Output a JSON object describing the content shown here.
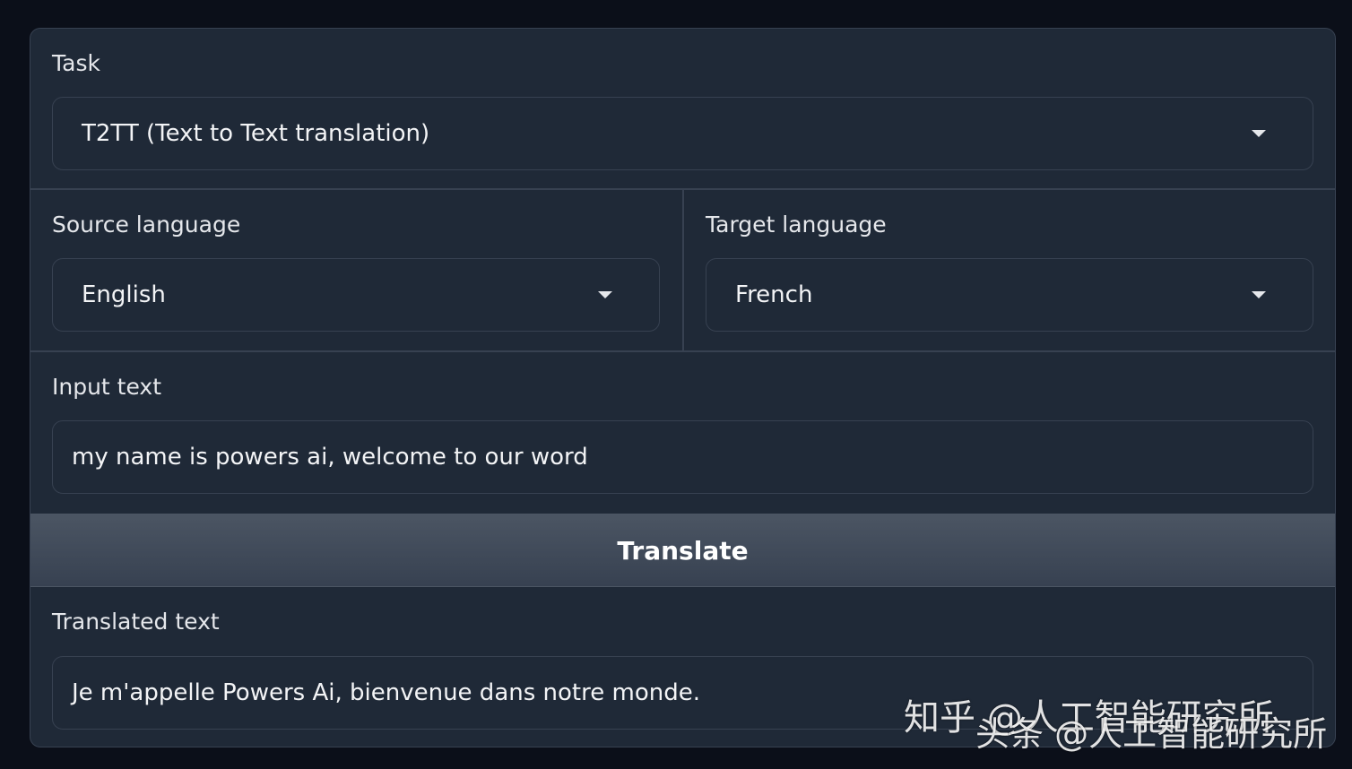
{
  "task": {
    "label": "Task",
    "value": "T2TT (Text to Text translation)"
  },
  "source_language": {
    "label": "Source language",
    "value": "English"
  },
  "target_language": {
    "label": "Target language",
    "value": "French"
  },
  "input_text": {
    "label": "Input text",
    "value": "my name is powers ai, welcome to our word"
  },
  "translate_button": {
    "label": "Translate"
  },
  "translated_text": {
    "label": "Translated text",
    "value": "Je m'appelle Powers Ai, bienvenue dans notre monde."
  },
  "watermarks": {
    "zhihu": "知乎 @人工智能研究所",
    "toutiao": "头条 @人工智能研究所"
  },
  "icons": {
    "dropdown": "chevron-down-icon"
  },
  "colors": {
    "background": "#0b0f19",
    "panel": "#1f2937",
    "border": "#374151",
    "button": "#4b5563"
  }
}
